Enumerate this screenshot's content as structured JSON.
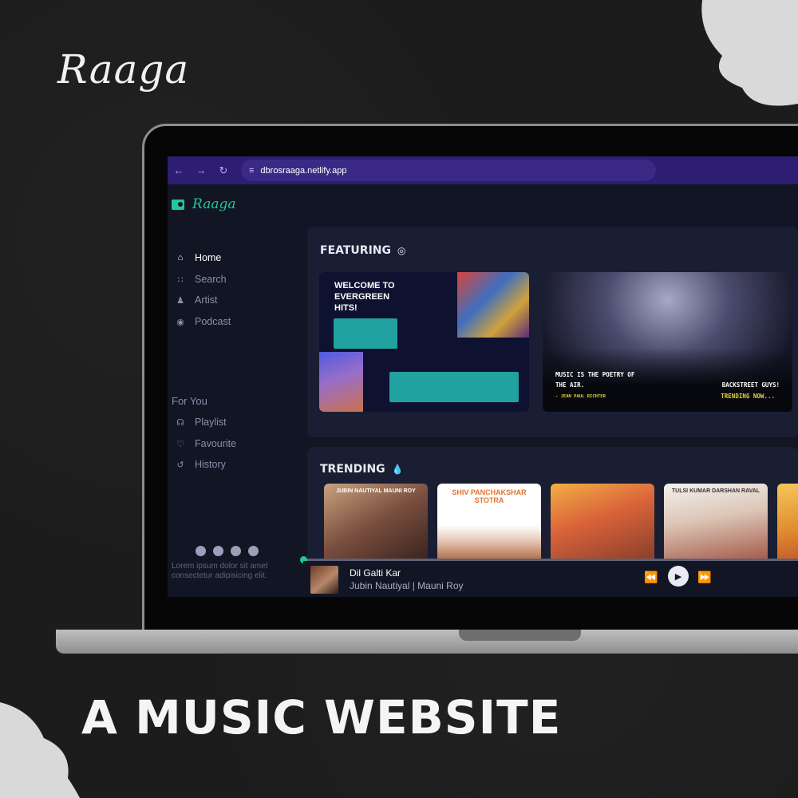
{
  "brand": {
    "script_logo": "Raaga"
  },
  "headline": "A MUSIC WEBSITE",
  "browser": {
    "url": "dbrosraaga.netlify.app",
    "icons": [
      "back-icon",
      "forward-icon",
      "reload-icon",
      "site-settings-icon"
    ]
  },
  "app": {
    "logo": "Raaga",
    "nav": [
      {
        "label": "Home",
        "icon": "home-icon"
      },
      {
        "label": "Search",
        "icon": "grid-icon"
      },
      {
        "label": "Artist",
        "icon": "users-icon"
      },
      {
        "label": "Podcast",
        "icon": "podcast-icon"
      }
    ],
    "for_you_label": "For You",
    "for_you": [
      {
        "label": "Playlist",
        "icon": "headphones-icon"
      },
      {
        "label": "Favourite",
        "icon": "heart-icon"
      },
      {
        "label": "History",
        "icon": "history-icon"
      }
    ],
    "social_icons": [
      "facebook-icon",
      "instagram-icon",
      "twitter-icon",
      "youtube-icon"
    ],
    "footer_text": "Lorem ipsum dolor sit amet consectetur adipisicing elit."
  },
  "featuring": {
    "title": "FEATURING",
    "card1": {
      "title": "WELCOME TO EVERGREEN HITS!"
    },
    "card2": {
      "quote": "MUSIC IS THE POETRY OF THE AIR.",
      "author": "- JEAN PAUL RICHTER",
      "headline": "BACKSTREET GUYS!",
      "subline": "TRENDING NOW..."
    }
  },
  "trending": {
    "title": "TRENDING",
    "covers": [
      {
        "label": "JUBIN NAUTIYAL   MAUNI ROY"
      },
      {
        "label": "SHIV PANCHAKSHAR STOTRA"
      },
      {
        "label": ""
      },
      {
        "label": "TULSI KUMAR   DARSHAN RAVAL"
      },
      {
        "label": ""
      }
    ]
  },
  "player": {
    "song": "Dil Galti Kar",
    "artist": "Jubin Nautiyal | Mauni Roy",
    "progress": 0.0
  },
  "colors": {
    "accent": "#20c997",
    "browser_bar": "#2d1d73",
    "app_bg": "#121524"
  }
}
